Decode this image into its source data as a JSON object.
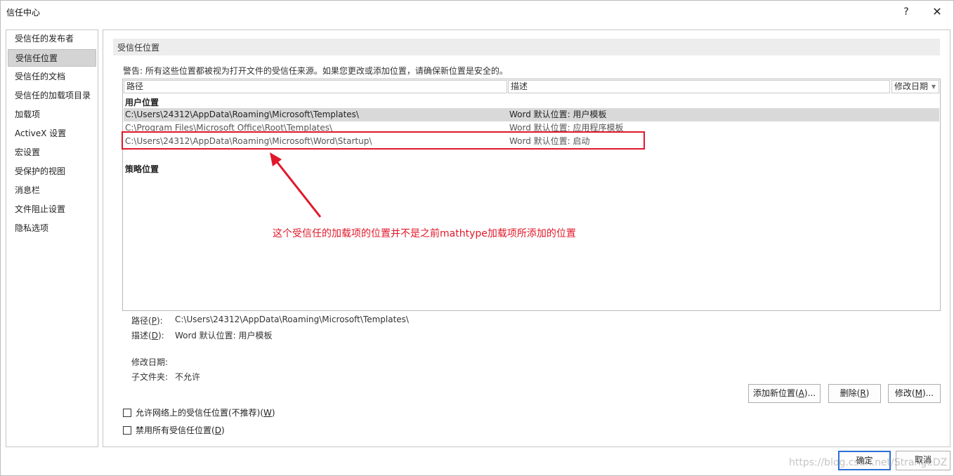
{
  "window": {
    "title": "信任中心",
    "help_label": "?",
    "close_label": "✕"
  },
  "sidebar": {
    "items": [
      {
        "label": "受信任的发布者"
      },
      {
        "label": "受信任位置"
      },
      {
        "label": "受信任的文档"
      },
      {
        "label": "受信任的加载项目录"
      },
      {
        "label": "加载项"
      },
      {
        "label": "ActiveX 设置"
      },
      {
        "label": "宏设置"
      },
      {
        "label": "受保护的视图"
      },
      {
        "label": "消息栏"
      },
      {
        "label": "文件阻止设置"
      },
      {
        "label": "隐私选项"
      }
    ],
    "selected_index": 1
  },
  "main": {
    "section_title": "受信任位置",
    "warning": "警告: 所有这些位置都被视为打开文件的受信任来源。如果您更改或添加位置，请确保新位置是安全的。",
    "columns": {
      "path": "路径",
      "description": "描述",
      "modified": "修改日期"
    },
    "user_group": {
      "label": "用户位置",
      "rows": [
        {
          "path": "C:\\Users\\24312\\AppData\\Roaming\\Microsoft\\Templates\\",
          "description": "Word 默认位置: 用户模板"
        },
        {
          "path": "C:\\Program Files\\Microsoft Office\\Root\\Templates\\",
          "description": "Word 默认位置: 应用程序模板"
        },
        {
          "path": "C:\\Users\\24312\\AppData\\Roaming\\Microsoft\\Word\\Startup\\",
          "description": "Word 默认位置: 启动"
        }
      ]
    },
    "policy_group": {
      "label": "策略位置"
    },
    "annotation": "这个受信任的加载项的位置并不是之前mathtype加载项所添加的位置",
    "details": {
      "path_label": "路径(",
      "path_key": "P",
      "path_label_end": "):",
      "path_value": "C:\\Users\\24312\\AppData\\Roaming\\Microsoft\\Templates\\",
      "desc_label": "描述(",
      "desc_key": "D",
      "desc_label_end": "):",
      "desc_value": "Word 默认位置: 用户模板",
      "modified_label": "修改日期:",
      "subfolder_label": "子文件夹:",
      "subfolder_value": "不允许"
    },
    "buttons": {
      "add_pre": "添加新位置(",
      "add_key": "A",
      "add_post": ")...",
      "remove_pre": "删除(",
      "remove_key": "R",
      "remove_post": ")",
      "modify_pre": "修改(",
      "modify_key": "M",
      "modify_post": ")..."
    },
    "checkboxes": {
      "network_pre": "允许网络上的受信任位置(不推荐)(",
      "network_key": "W",
      "network_post": ")",
      "network_checked": false,
      "disable_pre": "禁用所有受信任位置(",
      "disable_key": "D",
      "disable_post": ")",
      "disable_checked": false
    }
  },
  "footer": {
    "ok_label": "确定",
    "cancel_label": "取消",
    "watermark": "https://blog.csdn.net/StrangeDZ"
  },
  "colors": {
    "annotation_red": "#e0182a",
    "selected_row": "#d9d9d9",
    "ok_border": "#2b6fd6"
  }
}
